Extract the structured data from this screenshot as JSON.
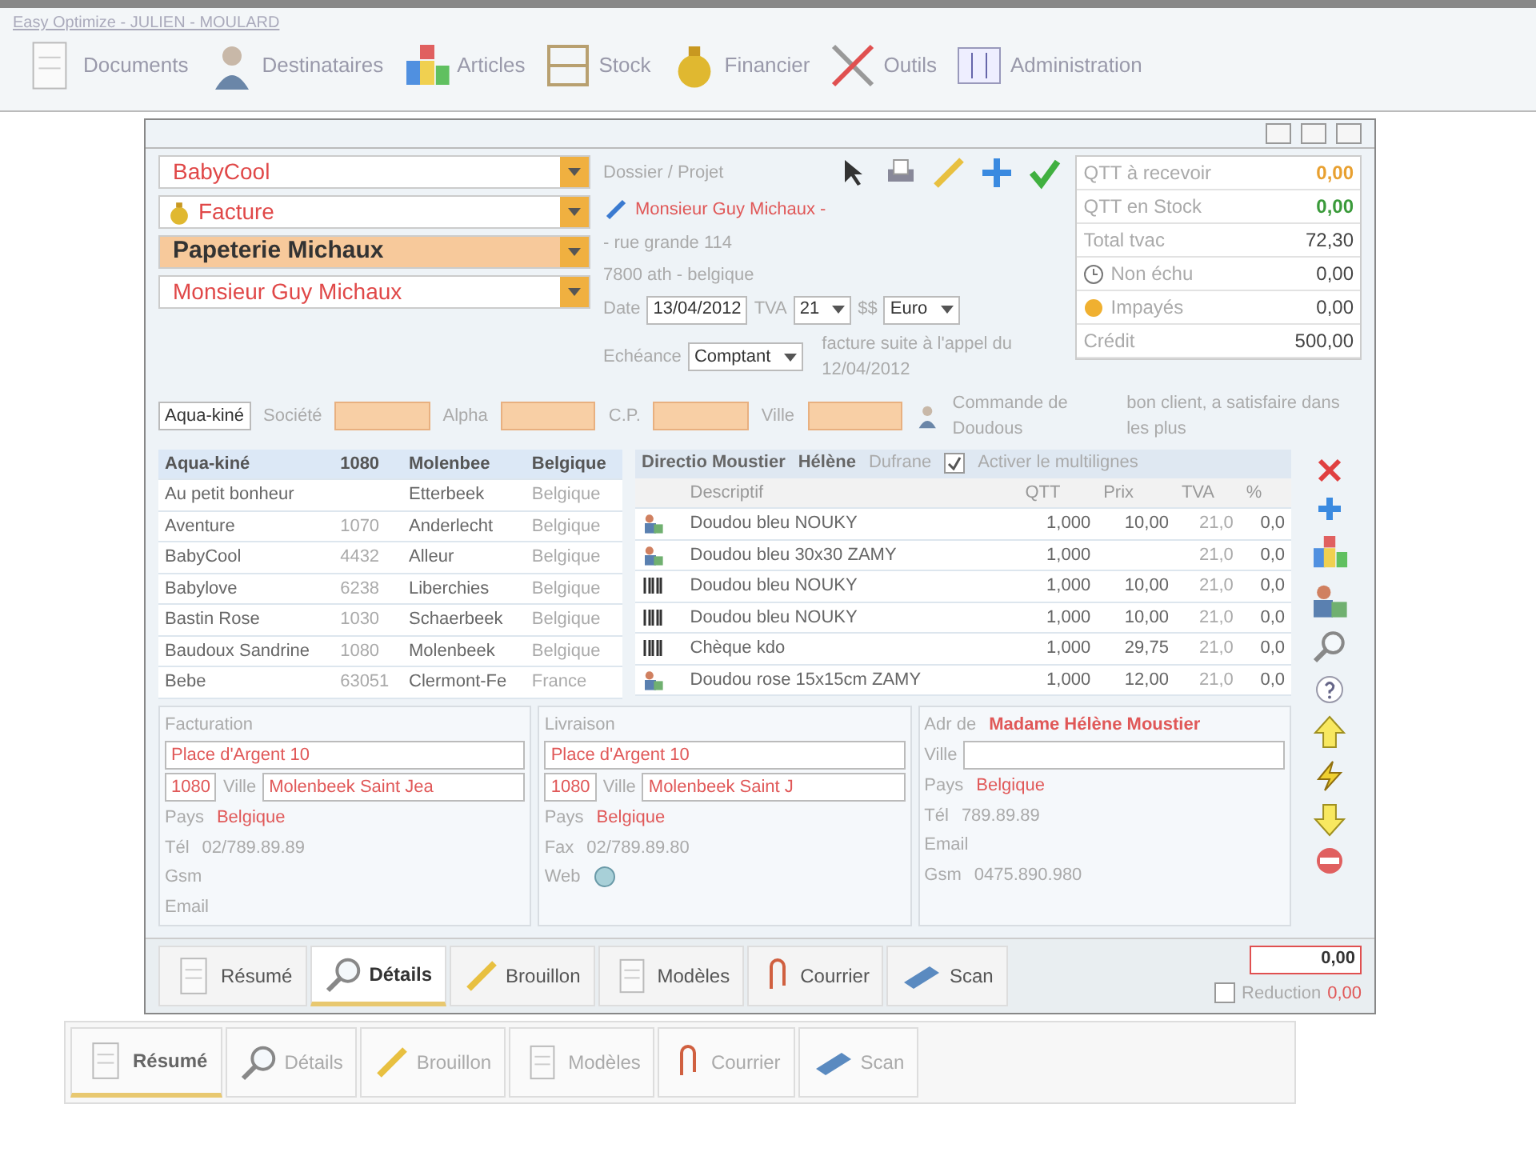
{
  "app": {
    "title": "Easy Optimize - JULIEN - MOULARD",
    "toolbar": [
      {
        "label": "Documents"
      },
      {
        "label": "Destinataires"
      },
      {
        "label": "Articles"
      },
      {
        "label": "Stock"
      },
      {
        "label": "Financier"
      },
      {
        "label": "Outils"
      },
      {
        "label": "Administration"
      }
    ]
  },
  "doc": {
    "combos": [
      {
        "value": "BabyCool",
        "kind": "plain"
      },
      {
        "value": "Facture",
        "kind": "bag"
      },
      {
        "value": "Papeterie Michaux",
        "kind": "strong"
      },
      {
        "value": "Monsieur Guy Michaux",
        "kind": "plain"
      }
    ],
    "dossier_label": "Dossier / Projet",
    "contact": "Monsieur Guy Michaux -",
    "address": [
      "- rue grande 114",
      "7800 ath - belgique"
    ],
    "date_label": "Date",
    "date": "13/04/2012",
    "tva_label": "TVA",
    "tva": "21",
    "currency_label": "$$",
    "currency": "Euro",
    "note": "facture suite à l'appel du 12/04/2012",
    "echeance_label": "Echéance",
    "echeance": "Comptant",
    "summary": [
      {
        "label": "QTT à recevoir",
        "value": "0,00",
        "color": "#e8a030"
      },
      {
        "label": "QTT en Stock",
        "value": "0,00",
        "color": "#3a9a3a"
      },
      {
        "label": "Total tvac",
        "value": "72,30",
        "color": "#444444"
      },
      {
        "label": "Non échu",
        "value": "0,00",
        "color": "#444444"
      },
      {
        "label": "Impayés",
        "value": "0,00",
        "color": "#444444"
      },
      {
        "label": "Crédit",
        "value": "500,00",
        "color": "#444444"
      }
    ],
    "search": {
      "labels": [
        "Société",
        "Alpha",
        "C.P.",
        "Ville"
      ],
      "value": "Aqua-kiné"
    },
    "subject": "Commande de Doudous",
    "remark": "bon client, a satisfaire dans les plus",
    "clients": [
      {
        "name": "Aqua-kiné",
        "cp": "1080",
        "city": "Molenbee",
        "country": "Belgique",
        "selected": true
      },
      {
        "name": "Au petit bonheur",
        "city": "Etterbeek",
        "country": "Belgique",
        "selected": false
      },
      {
        "name": "Aventure",
        "cp": "1070",
        "city": "Anderlecht",
        "country": "Belgique",
        "selected": false
      },
      {
        "name": "BabyCool",
        "cp": "4432",
        "city": "Alleur",
        "country": "Belgique",
        "selected": false
      },
      {
        "name": "Babylove",
        "cp": "6238",
        "city": "Liberchies",
        "country": "Belgique",
        "selected": false
      },
      {
        "name": "Bastin Rose",
        "cp": "1030",
        "city": "Schaerbeek",
        "country": "Belgique",
        "selected": false
      },
      {
        "name": "Baudoux Sandrine",
        "cp": "1080",
        "city": "Molenbeek",
        "country": "Belgique",
        "selected": false
      },
      {
        "name": "Bebe",
        "cp": "63051",
        "city": "Clermont-Fe",
        "country": "France",
        "selected": false
      }
    ],
    "lines_bar": {
      "contact": "Directio Moustier",
      "first_name": "Hélène",
      "author": "Dufrane",
      "multiline_label": "Activer le multilignes",
      "multiline": true
    },
    "line_columns": [
      "Descriptif",
      "QTT",
      "Prix",
      "TVA",
      "%"
    ],
    "lines": [
      {
        "kind": "people",
        "cells": [
          "Doudou bleu NOUKY",
          "1,000",
          "10,00",
          "21,0",
          "0,0"
        ]
      },
      {
        "kind": "people",
        "cells": [
          "Doudou bleu 30x30 ZAMY",
          "1,000",
          "",
          "21,0",
          "0,0"
        ]
      },
      {
        "kind": "barcode",
        "cells": [
          "Doudou bleu NOUKY",
          "1,000",
          "10,00",
          "21,0",
          "0,0"
        ]
      },
      {
        "kind": "barcode",
        "cells": [
          "Doudou bleu NOUKY",
          "1,000",
          "10,00",
          "21,0",
          "0,0"
        ]
      },
      {
        "kind": "barcode",
        "cells": [
          "Chèque kdo",
          "1,000",
          "29,75",
          "21,0",
          "0,0"
        ]
      },
      {
        "kind": "people",
        "cells": [
          "Doudou rose 15x15cm ZAMY",
          "1,000",
          "12,00",
          "21,0",
          "0,0"
        ]
      }
    ],
    "addresses": [
      {
        "title": "Facturation",
        "street": "Place d'Argent 10",
        "cp": "1080",
        "city_label": "Ville",
        "city": "Molenbeek Saint Jea",
        "country_label": "Pays",
        "country": "Belgique",
        "contacts": [
          {
            "label": "Tél",
            "value": "02/789.89.89"
          },
          {
            "label": "Gsm"
          },
          {
            "label": "Email"
          }
        ]
      },
      {
        "title": "Livraison",
        "street": "Place d'Argent 10",
        "cp": "1080",
        "city_label": "Ville",
        "city": "Molenbeek Saint J",
        "country_label": "Pays",
        "country": "Belgique",
        "contacts": [
          {
            "label": "Fax",
            "value": "02/789.89.80"
          },
          {
            "label": "Web",
            "kind": "globe"
          }
        ]
      },
      {
        "title": "Adr de",
        "name": "Madame Hélène Moustier",
        "city_label": "Ville",
        "country_label": "Pays",
        "country": "Belgique",
        "contacts": [
          {
            "label": "Tél",
            "value": "789.89.89"
          },
          {
            "label": "Email"
          },
          {
            "label": "Gsm",
            "value": "0475.890.980"
          }
        ]
      }
    ],
    "tabs": [
      {
        "label": "Résumé",
        "selected": false
      },
      {
        "label": "Détails",
        "selected": true
      },
      {
        "label": "Brouillon",
        "selected": false
      },
      {
        "label": "Modèles",
        "selected": false
      },
      {
        "label": "Courrier",
        "selected": false
      },
      {
        "label": "Scan",
        "selected": false
      }
    ],
    "total": "0,00",
    "reduction_label": "Reduction",
    "reduction": false,
    "reduction_value": "0,00"
  },
  "back_tabs": [
    {
      "label": "Résumé",
      "selected": true
    },
    {
      "label": "Détails",
      "selected": false
    },
    {
      "label": "Brouillon",
      "selected": false
    },
    {
      "label": "Modèles",
      "selected": false
    },
    {
      "label": "Courrier",
      "selected": false
    },
    {
      "label": "Scan",
      "selected": false
    }
  ]
}
